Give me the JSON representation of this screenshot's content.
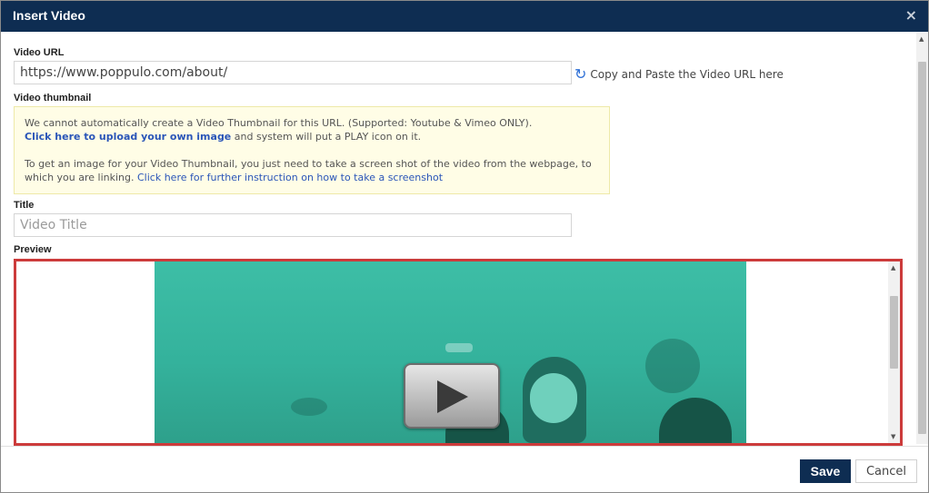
{
  "dialog": {
    "title": "Insert Video",
    "close_glyph": "×"
  },
  "video_url": {
    "label": "Video URL",
    "value": "https://www.poppulo.com/about/",
    "hint": "Copy and Paste the Video URL here",
    "hint_icon": "refresh-icon"
  },
  "thumbnail": {
    "label": "Video thumbnail",
    "notice_line1": "We cannot automatically create a Video Thumbnail for this URL. (Supported: Youtube & Vimeo ONLY).",
    "upload_link": "Click here to upload your own image",
    "upload_suffix": " and system will put a PLAY icon on it.",
    "instruction_text": "To get an image for your Video Thumbnail, you just need to take a screen shot of the video from the webpage, to which you are linking. ",
    "instruction_link": "Click here for further instruction on how to take a screenshot"
  },
  "title_field": {
    "label": "Title",
    "placeholder": "Video Title"
  },
  "preview": {
    "label": "Preview",
    "play_icon": "play-icon"
  },
  "footer": {
    "save_label": "Save",
    "cancel_label": "Cancel"
  },
  "colors": {
    "header_bg": "#0e2d52",
    "preview_border": "#cc3b3b",
    "link": "#2a55b8",
    "notice_bg": "#fffde6"
  }
}
